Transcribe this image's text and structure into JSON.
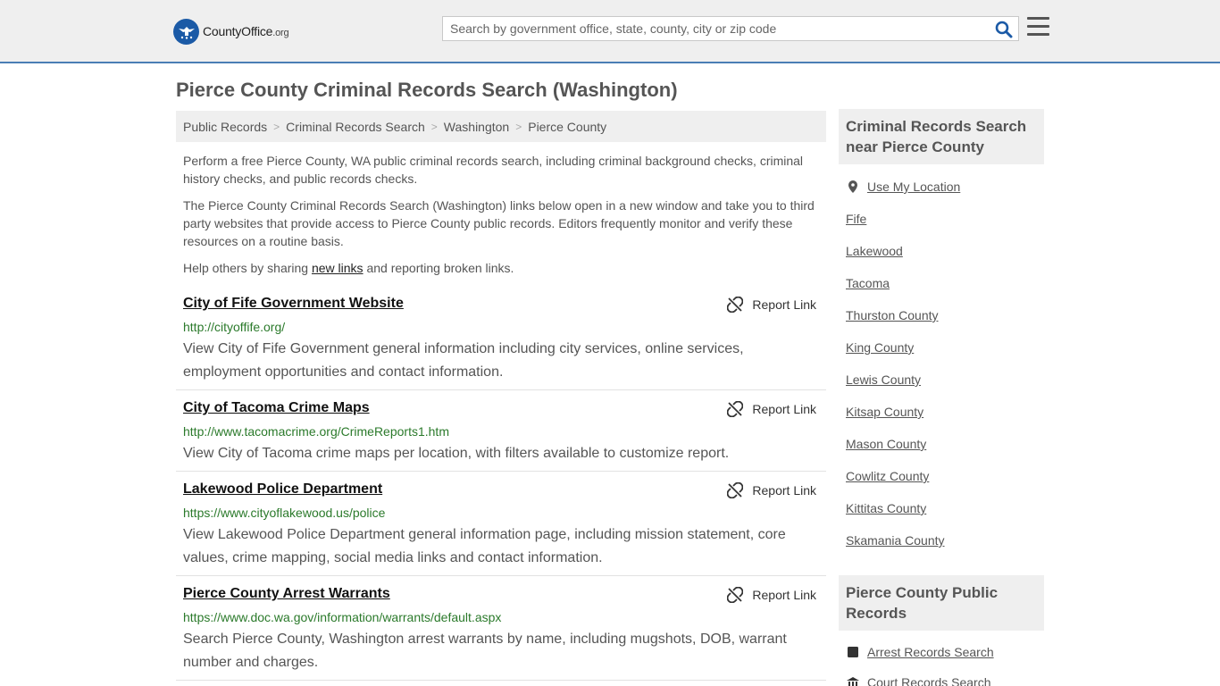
{
  "header": {
    "logo_text": "CountyOffice",
    "logo_suffix": ".org",
    "search_placeholder": "Search by government office, state, county, city or zip code"
  },
  "page_title": "Pierce County Criminal Records Search (Washington)",
  "breadcrumb": [
    "Public Records",
    "Criminal Records Search",
    "Washington",
    "Pierce County"
  ],
  "intro": {
    "p1": "Perform a free Pierce County, WA public criminal records search, including criminal background checks, criminal history checks, and public records checks.",
    "p2": "The Pierce County Criminal Records Search (Washington) links below open in a new window and take you to third party websites that provide access to Pierce County public records. Editors frequently monitor and verify these resources on a routine basis.",
    "p3_before": "Help others by sharing ",
    "p3_link": "new links",
    "p3_after": " and reporting broken links."
  },
  "report_label": "Report Link",
  "listings": [
    {
      "title": "City of Fife Government Website",
      "url": "http://cityoffife.org/",
      "desc": "View City of Fife Government general information including city services, online services, employment opportunities and contact information."
    },
    {
      "title": "City of Tacoma Crime Maps",
      "url": "http://www.tacomacrime.org/CrimeReports1.htm",
      "desc": "View City of Tacoma crime maps per location, with filters available to customize report."
    },
    {
      "title": "Lakewood Police Department",
      "url": "https://www.cityoflakewood.us/police",
      "desc": "View Lakewood Police Department general information page, including mission statement, core values, crime mapping, social media links and contact information."
    },
    {
      "title": "Pierce County Arrest Warrants",
      "url": "https://www.doc.wa.gov/information/warrants/default.aspx",
      "desc": "Search Pierce County, Washington arrest warrants by name, including mugshots, DOB, warrant number and charges."
    }
  ],
  "sidebar": {
    "nearby_heading": "Criminal Records Search near Pierce County",
    "use_location": "Use My Location",
    "nearby": [
      "Fife",
      "Lakewood",
      "Tacoma",
      "Thurston County",
      "King County",
      "Lewis County",
      "Kitsap County",
      "Mason County",
      "Cowlitz County",
      "Kittitas County",
      "Skamania County"
    ],
    "public_heading": "Pierce County Public Records",
    "public_links": [
      "Arrest Records Search",
      "Court Records Search"
    ]
  }
}
